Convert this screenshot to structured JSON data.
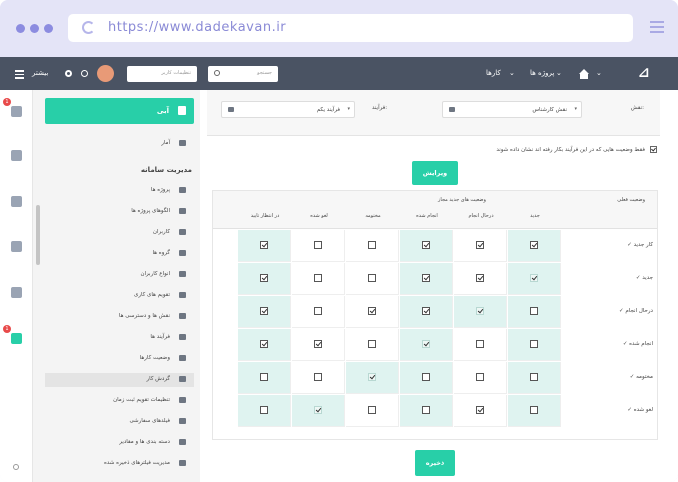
{
  "browser": {
    "url": "https://www.dadekavan.ir"
  },
  "topbar": {
    "logout_label": "بیشتر",
    "search_placeholder": "جستجو",
    "profile_placeholder": "تنظیمات کاربر",
    "nav": [
      {
        "label": "کارها"
      },
      {
        "label": "پروژه ها"
      }
    ]
  },
  "sidebar": {
    "primary_button": "آبی",
    "stats_label": "آمار",
    "section_title": "مدیریت سامانه",
    "items": [
      {
        "label": "پروژه ها"
      },
      {
        "label": "الگوهای پروژه ها"
      },
      {
        "label": "کاربران"
      },
      {
        "label": "گروه ها"
      },
      {
        "label": "انواع کاربران"
      },
      {
        "label": "تقویم های کاری"
      },
      {
        "label": "نقش ها و دسترسی ها"
      },
      {
        "label": "فرآیند ها"
      },
      {
        "label": "وضعیت کارها"
      },
      {
        "label": "گردش کار"
      },
      {
        "label": "تنظیمات تقویم ثبت زمان"
      },
      {
        "label": "فیلدهای سفارشی"
      },
      {
        "label": "دسته بندی ها و مقادیر"
      },
      {
        "label": "مدیریت فیلترهای ذخیره شده"
      }
    ]
  },
  "filter": {
    "role_label": "نقش:",
    "role_value": "نقش کارشناس",
    "process_label": "فرآیند:",
    "process_value": "فرآیند یکم",
    "only_used_label": "فقط وضعیت هایی که در این فرآیند بکار رفته اند نشان داده شوند",
    "edit_button": "ویرایش"
  },
  "grid": {
    "status_header": "وضعیت فعلی",
    "allowed_header": "وضعیت های جدید مجاز",
    "columns": [
      "جدید",
      "درحال انجام",
      "انجام شده",
      "مختومه",
      "لغو شده",
      "در انتظار تایید"
    ],
    "rows": [
      {
        "label": "کار جدید",
        "cells": [
          1,
          1,
          1,
          0,
          0,
          1
        ]
      },
      {
        "label": "جدید",
        "cells": [
          2,
          1,
          1,
          0,
          0,
          1
        ]
      },
      {
        "label": "درحال انجام",
        "cells": [
          0,
          2,
          1,
          1,
          0,
          1
        ]
      },
      {
        "label": "انجام شده",
        "cells": [
          0,
          0,
          2,
          0,
          1,
          1
        ]
      },
      {
        "label": "مختومه",
        "cells": [
          0,
          0,
          0,
          2,
          0,
          0
        ]
      },
      {
        "label": "لغو شده",
        "cells": [
          0,
          1,
          0,
          0,
          2,
          0
        ]
      }
    ]
  },
  "save_button": "ذخیره",
  "colors": {
    "accent": "#28cfa8",
    "topbar": "#4a5363",
    "badge": "#e84a4a"
  }
}
